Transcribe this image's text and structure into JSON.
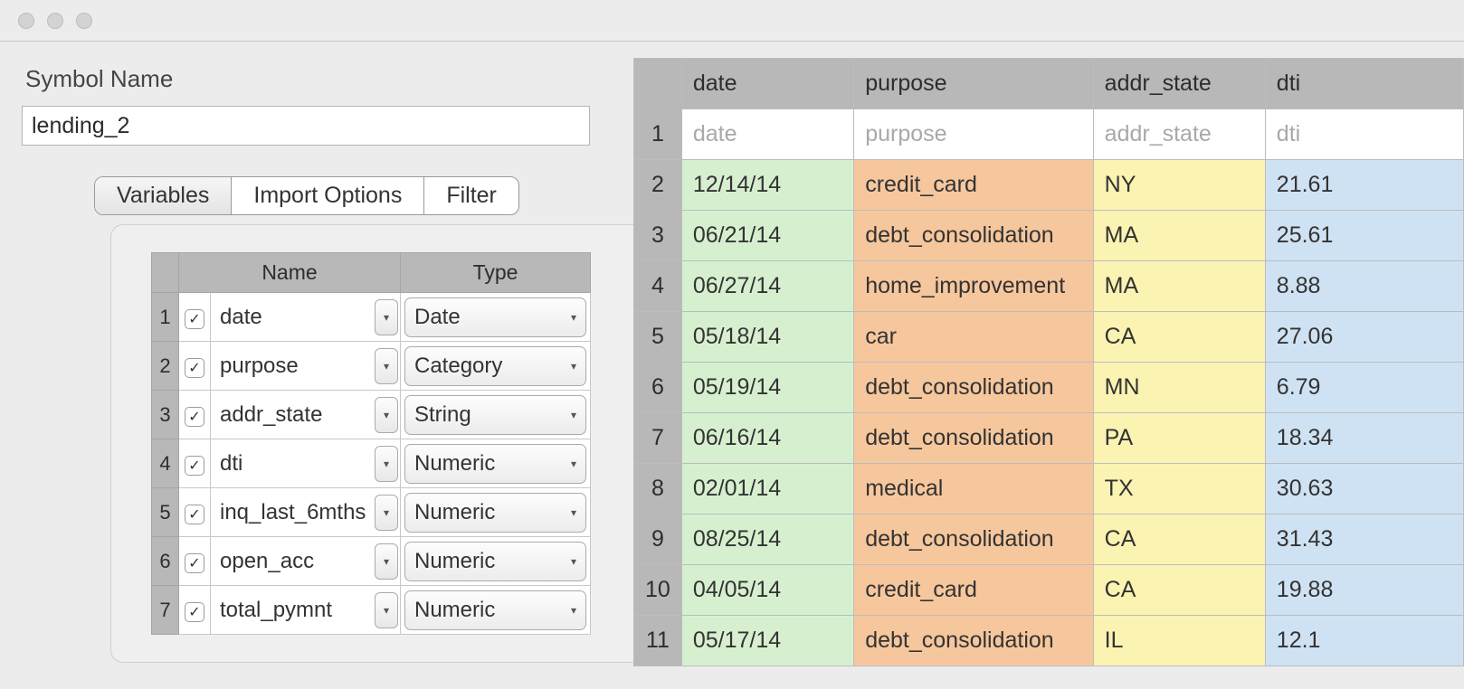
{
  "symbol": {
    "label": "Symbol Name",
    "value": "lending_2"
  },
  "tabs": {
    "variables": "Variables",
    "import_options": "Import Options",
    "filter": "Filter"
  },
  "vars_headers": {
    "name": "Name",
    "type": "Type"
  },
  "variables": [
    {
      "n": "1",
      "name": "date",
      "type": "Date"
    },
    {
      "n": "2",
      "name": "purpose",
      "type": "Category"
    },
    {
      "n": "3",
      "name": "addr_state",
      "type": "String"
    },
    {
      "n": "4",
      "name": "dti",
      "type": "Numeric"
    },
    {
      "n": "5",
      "name": "inq_last_6mths",
      "type": "Numeric"
    },
    {
      "n": "6",
      "name": "open_acc",
      "type": "Numeric"
    },
    {
      "n": "7",
      "name": "total_pymnt",
      "type": "Numeric"
    }
  ],
  "preview": {
    "columns": {
      "date": "date",
      "purpose": "purpose",
      "addr_state": "addr_state",
      "dti": "dti"
    },
    "header_row_n": "1",
    "rows": [
      {
        "n": "2",
        "date": "12/14/14",
        "purpose": "credit_card",
        "state": "NY",
        "dti": "21.61"
      },
      {
        "n": "3",
        "date": "06/21/14",
        "purpose": "debt_consolidation",
        "state": "MA",
        "dti": "25.61"
      },
      {
        "n": "4",
        "date": "06/27/14",
        "purpose": "home_improvement",
        "state": "MA",
        "dti": "8.88"
      },
      {
        "n": "5",
        "date": "05/18/14",
        "purpose": "car",
        "state": "CA",
        "dti": "27.06"
      },
      {
        "n": "6",
        "date": "05/19/14",
        "purpose": "debt_consolidation",
        "state": "MN",
        "dti": "6.79"
      },
      {
        "n": "7",
        "date": "06/16/14",
        "purpose": "debt_consolidation",
        "state": "PA",
        "dti": "18.34"
      },
      {
        "n": "8",
        "date": "02/01/14",
        "purpose": "medical",
        "state": "TX",
        "dti": "30.63"
      },
      {
        "n": "9",
        "date": "08/25/14",
        "purpose": "debt_consolidation",
        "state": "CA",
        "dti": "31.43"
      },
      {
        "n": "10",
        "date": "04/05/14",
        "purpose": "credit_card",
        "state": "CA",
        "dti": "19.88"
      },
      {
        "n": "11",
        "date": "05/17/14",
        "purpose": "debt_consolidation",
        "state": "IL",
        "dti": "12.1"
      }
    ]
  }
}
